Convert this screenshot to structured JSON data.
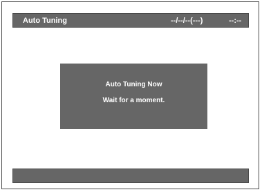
{
  "header": {
    "title": "Auto Tuning",
    "date": "--/--/--(---)",
    "time": "--:--"
  },
  "dialog": {
    "line1": "Auto Tuning Now",
    "line2": "Wait for a moment."
  },
  "colors": {
    "bar_background": "#666666",
    "text": "#ffffff",
    "page_background": "#ffffff",
    "border": "#4a4a4a"
  }
}
